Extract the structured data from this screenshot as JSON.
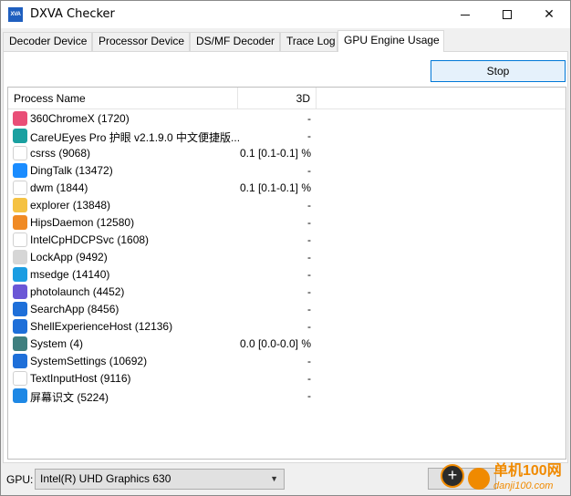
{
  "window": {
    "app_icon_text": "XVA",
    "title": "DXVA Checker",
    "minimize_icon": "minimize-icon",
    "maximize_icon": "maximize-icon",
    "close_icon": "close-icon",
    "close_glyph": "✕"
  },
  "tabs": [
    {
      "label": "Decoder Device"
    },
    {
      "label": "Processor Device"
    },
    {
      "label": "DS/MF Decoder"
    },
    {
      "label": "Trace Log"
    },
    {
      "label": "GPU Engine Usage",
      "active": true
    }
  ],
  "toolbar": {
    "stop_label": "Stop"
  },
  "table": {
    "headers": {
      "name": "Process Name",
      "d3": "3D"
    },
    "rows": [
      {
        "name": "360ChromeX (1720)",
        "value": "-",
        "icon": "360chrome-icon",
        "color": "#e94e77"
      },
      {
        "name": "CareUEyes Pro 护眼 v2.1.9.0 中文便捷版...",
        "value": "-",
        "icon": "eye-icon",
        "color": "#1aa0a0"
      },
      {
        "name": "csrss (9068)",
        "value": "0.1 [0.1-0.1] %",
        "icon": "blank-icon",
        "color": "#ffffff"
      },
      {
        "name": "DingTalk (13472)",
        "value": "-",
        "icon": "dingtalk-icon",
        "color": "#1a8cff"
      },
      {
        "name": "dwm (1844)",
        "value": "0.1 [0.1-0.1] %",
        "icon": "blank-icon",
        "color": "#ffffff"
      },
      {
        "name": "explorer (13848)",
        "value": "-",
        "icon": "folder-icon",
        "color": "#f5c242"
      },
      {
        "name": "HipsDaemon (12580)",
        "value": "-",
        "icon": "shield-icon",
        "color": "#f08a24"
      },
      {
        "name": "IntelCpHDCPSvc (1608)",
        "value": "-",
        "icon": "blank-icon",
        "color": "#ffffff"
      },
      {
        "name": "LockApp (9492)",
        "value": "-",
        "icon": "lockapp-icon",
        "color": "#d6d6d6"
      },
      {
        "name": "msedge (14140)",
        "value": "-",
        "icon": "edge-icon",
        "color": "#1b9de2"
      },
      {
        "name": "photolaunch (4452)",
        "value": "-",
        "icon": "photo-icon",
        "color": "#6b57d6"
      },
      {
        "name": "SearchApp (8456)",
        "value": "-",
        "icon": "search-icon",
        "color": "#1e6fd9"
      },
      {
        "name": "ShellExperienceHost (12136)",
        "value": "-",
        "icon": "window-icon",
        "color": "#1e6fd9"
      },
      {
        "name": "System (4)",
        "value": "0.0 [0.0-0.0] %",
        "icon": "system-icon",
        "color": "#3f7f7f"
      },
      {
        "name": "SystemSettings (10692)",
        "value": "-",
        "icon": "gear-icon",
        "color": "#1e6fd9"
      },
      {
        "name": "TextInputHost (9116)",
        "value": "-",
        "icon": "blank-icon",
        "color": "#ffffff"
      },
      {
        "name": "屏幕识文 (5224)",
        "value": "-",
        "icon": "text-recognize-icon",
        "color": "#1e88e5"
      }
    ]
  },
  "footer": {
    "gpu_label": "GPU:",
    "gpu_value": "Intel(R) UHD Graphics 630",
    "watermark_title": "单机100网",
    "watermark_url": "danji100.com"
  }
}
